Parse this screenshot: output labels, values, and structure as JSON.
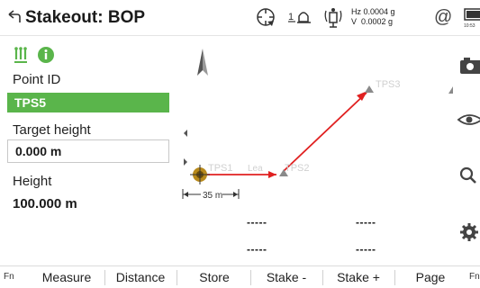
{
  "header": {
    "title": "Stakeout: BOP",
    "hz_readout": "Hz 0.0004 g",
    "v_readout": "V  0.0002 g",
    "at_symbol": "@",
    "time": "10:53",
    "bubble_label": "1"
  },
  "fields": {
    "point_id_label": "Point ID",
    "point_id_value": "TPS5",
    "target_height_label": "Target height",
    "target_height_value": "0.000 m",
    "height_label": "Height",
    "height_value": "100.000 m"
  },
  "map": {
    "points": [
      {
        "label": "TPS1"
      },
      {
        "label": "TPS2"
      },
      {
        "label": "TPS3"
      }
    ],
    "station_label": "Lea",
    "scale_label": "35 m",
    "stat_values": [
      "-----",
      "-----",
      "-----",
      "-----"
    ]
  },
  "softkeys": {
    "fn_left": "Fn",
    "fn_right": "Fn",
    "measure": "Measure",
    "distance": "Distance",
    "store": "Store",
    "stake_minus": "Stake -",
    "stake_plus": "Stake +",
    "page": "Page"
  },
  "colors": {
    "accent_green": "#5ab54b",
    "route_red": "#e02020"
  },
  "icons": [
    "back-icon",
    "gps-icon",
    "level-bubble-icon",
    "satellite-icon",
    "battery-icon",
    "points-list-icon",
    "info-icon",
    "camera-icon",
    "eye-icon",
    "search-icon",
    "settings-gear-icon"
  ]
}
